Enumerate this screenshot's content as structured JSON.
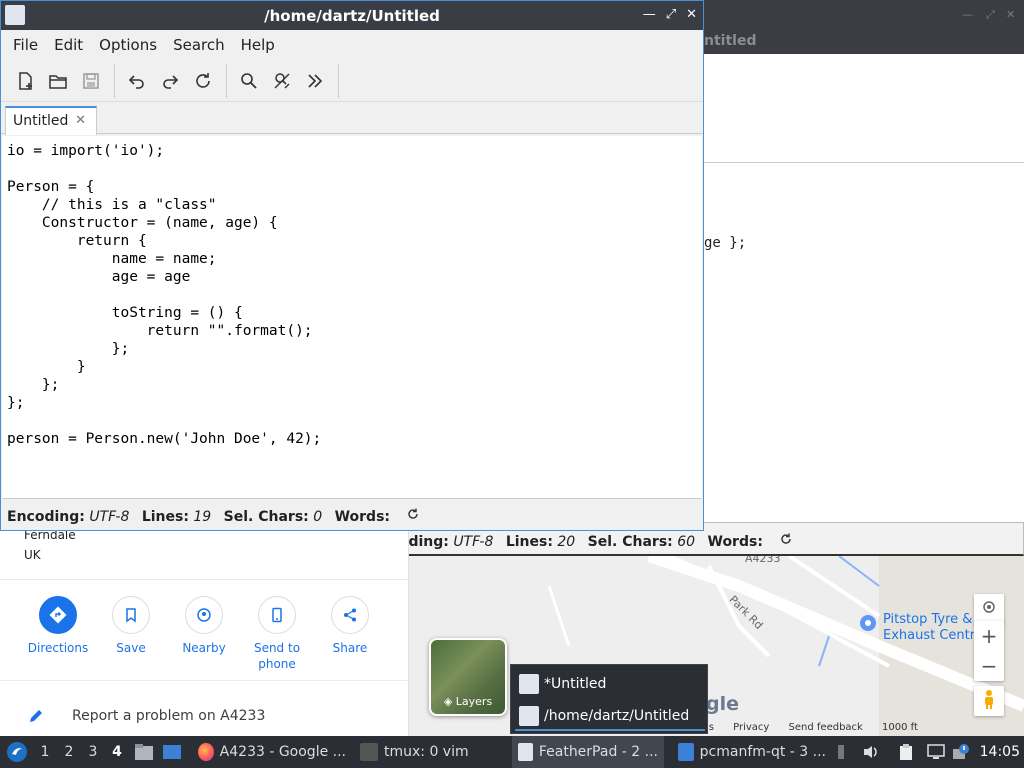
{
  "main_window": {
    "title": "/home/dartz/Untitled",
    "menu": [
      "File",
      "Edit",
      "Options",
      "Search",
      "Help"
    ],
    "tab_label": "Untitled",
    "code_lines": [
      "io = import('io');",
      "",
      "Person = {",
      "    // this is a \"class\"",
      "    Constructor = (name, age) {",
      "        return {",
      "            name = name;",
      "            age = age",
      "",
      "            toString = () {",
      "                return \"\".format();",
      "            };",
      "        }",
      "    };",
      "};",
      "",
      "person = Person.new('John Doe', 42);"
    ],
    "status": {
      "encoding_label": "Encoding:",
      "encoding_value": "UTF-8",
      "lines_label": "Lines:",
      "lines_value": "19",
      "sel_label": "Sel. Chars:",
      "sel_value": "0",
      "words_label": "Words:"
    }
  },
  "bg_window": {
    "tab_fragment": "ntitled",
    "code_fragment": "ge };",
    "status": {
      "encoding_label": "Encoding:",
      "encoding_value": "UTF-8",
      "lines_label": "Lines:",
      "lines_value": "20",
      "sel_label": "Sel. Chars:",
      "sel_value": "60",
      "words_label": "Words:"
    }
  },
  "maps": {
    "address_lines": [
      "Ferndale",
      "UK"
    ],
    "actions": [
      {
        "label": "Directions",
        "icon": "directions-icon"
      },
      {
        "label": "Save",
        "icon": "bookmark-icon"
      },
      {
        "label": "Nearby",
        "icon": "nearby-icon"
      },
      {
        "label": "Send to phone",
        "icon": "phone-icon"
      },
      {
        "label": "Share",
        "icon": "share-icon"
      }
    ],
    "report_text": "Report a problem on A4233",
    "road_a4233": "A4233",
    "road_park": "Park Rd",
    "poi": "Pitstop Tyre & Exhaust Centre",
    "layers_label": "Layers",
    "footer": [
      "ms",
      "Privacy",
      "Send feedback",
      "1000 ft"
    ],
    "google_fragment": "ogle"
  },
  "taskbar_popup": {
    "items": [
      "*Untitled",
      "/home/dartz/Untitled"
    ]
  },
  "taskbar": {
    "desktops": [
      "1",
      "2",
      "3",
      "4"
    ],
    "active_desktop": "4",
    "tasks": [
      {
        "label": "A4233 - Google ..."
      },
      {
        "label": "tmux: 0 vim"
      },
      {
        "label": "FeatherPad - 2 ..."
      },
      {
        "label": "pcmanfm-qt - 3 ..."
      }
    ],
    "clock": "14:05"
  },
  "colors": {
    "titlebar": "#3a3d44",
    "accent": "#4a90d9",
    "maps_blue": "#1a73e8",
    "taskbar": "#2b2e34"
  }
}
